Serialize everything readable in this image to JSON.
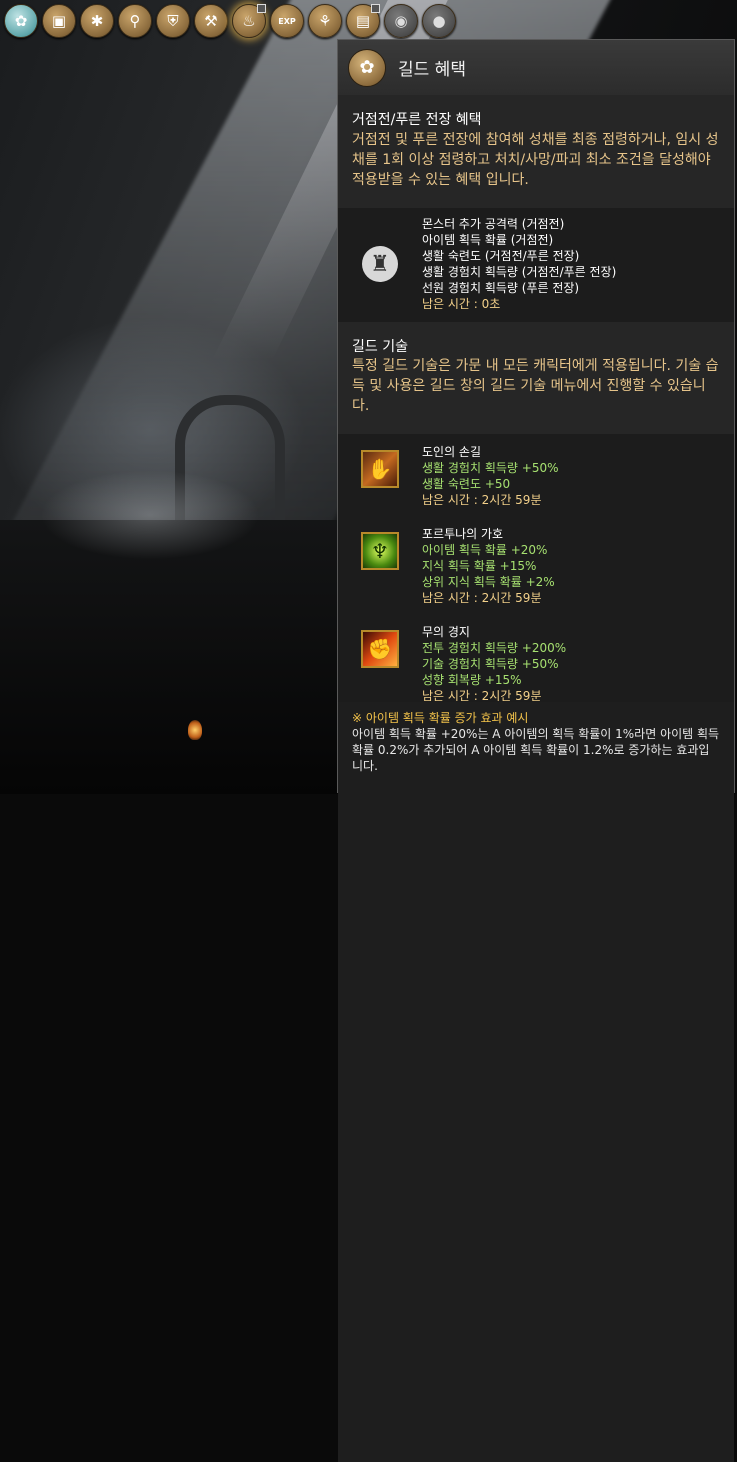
{
  "toolbar": {
    "icons": [
      {
        "name": "guild-emblem-icon",
        "glyph": "✿"
      },
      {
        "name": "bag-icon",
        "glyph": "▣"
      },
      {
        "name": "skill-tree-icon",
        "glyph": "✱"
      },
      {
        "name": "search-icon",
        "glyph": "⚲"
      },
      {
        "name": "shield-icon",
        "glyph": "⛨"
      },
      {
        "name": "craft-icon",
        "glyph": "⚒"
      },
      {
        "name": "candle-icon",
        "glyph": "♨"
      },
      {
        "name": "exp-icon",
        "label": "EXP"
      },
      {
        "name": "party-icon",
        "glyph": "⚘"
      },
      {
        "name": "map-scroll-icon",
        "glyph": "▤"
      },
      {
        "name": "palette-icon",
        "glyph": "◉"
      },
      {
        "name": "person-icon",
        "glyph": "●"
      }
    ]
  },
  "panel": {
    "title": "길드 혜택",
    "stronghold": {
      "heading": "거점전/푸른 전장 혜택",
      "description": "거점전 및 푸른 전장에 참여해 성채를 최종 점령하거나, 임시 성채를 1회 이상 점령하고 처치/사망/파괴 최소 조건을 달성해야 적용받을 수 있는 혜택 입니다.",
      "benefits": [
        "몬스터 추가 공격력 (거점전)",
        "아이템 획득 확률 (거점전)",
        "생활 숙련도 (거점전/푸른 전장)",
        "생활 경험치 획득량 (거점전/푸른 전장)",
        "선원 경험치 획득량 (푸른 전장)"
      ],
      "remaining": "남은 시간 : 0초"
    },
    "guild_skill": {
      "heading": "길드 기술",
      "description": "특정 길드 기술은 가문 내 모든 캐릭터에게 적용됩니다. 기술 습득 및 사용은 길드 창의 길드 기술 메뉴에서 진행할 수 있습니다.",
      "skills": [
        {
          "name": "도인의 손길",
          "effects": [
            "생활 경험치 획득량 +50%",
            "생활 숙련도 +50"
          ],
          "remaining": "남은 시간 : 2시간 59분"
        },
        {
          "name": "포르투나의 가호",
          "effects": [
            "아이템 획득 확률 +20%",
            "지식 획득 확률 +15%",
            "상위 지식 획득 확률 +2%"
          ],
          "remaining": "남은 시간 : 2시간 59분"
        },
        {
          "name": "무의 경지",
          "effects": [
            "전투 경험치 획득량 +200%",
            "기술 경험치 획득량 +50%",
            "성향 회복량 +15%"
          ],
          "remaining": "남은 시간 : 2시간 59분"
        }
      ]
    },
    "footer": {
      "note_title": "※ 아이템 획득 확률 증가 효과 예시",
      "note_text": "아이템 획득 확률 +20%는 A 아이템의 획득 확률이 1%라면 아이템 획득 확률 0.2%가 추가되어 A 아이템 획득 확률이 1.2%로 증가하는 효과입니다."
    }
  }
}
